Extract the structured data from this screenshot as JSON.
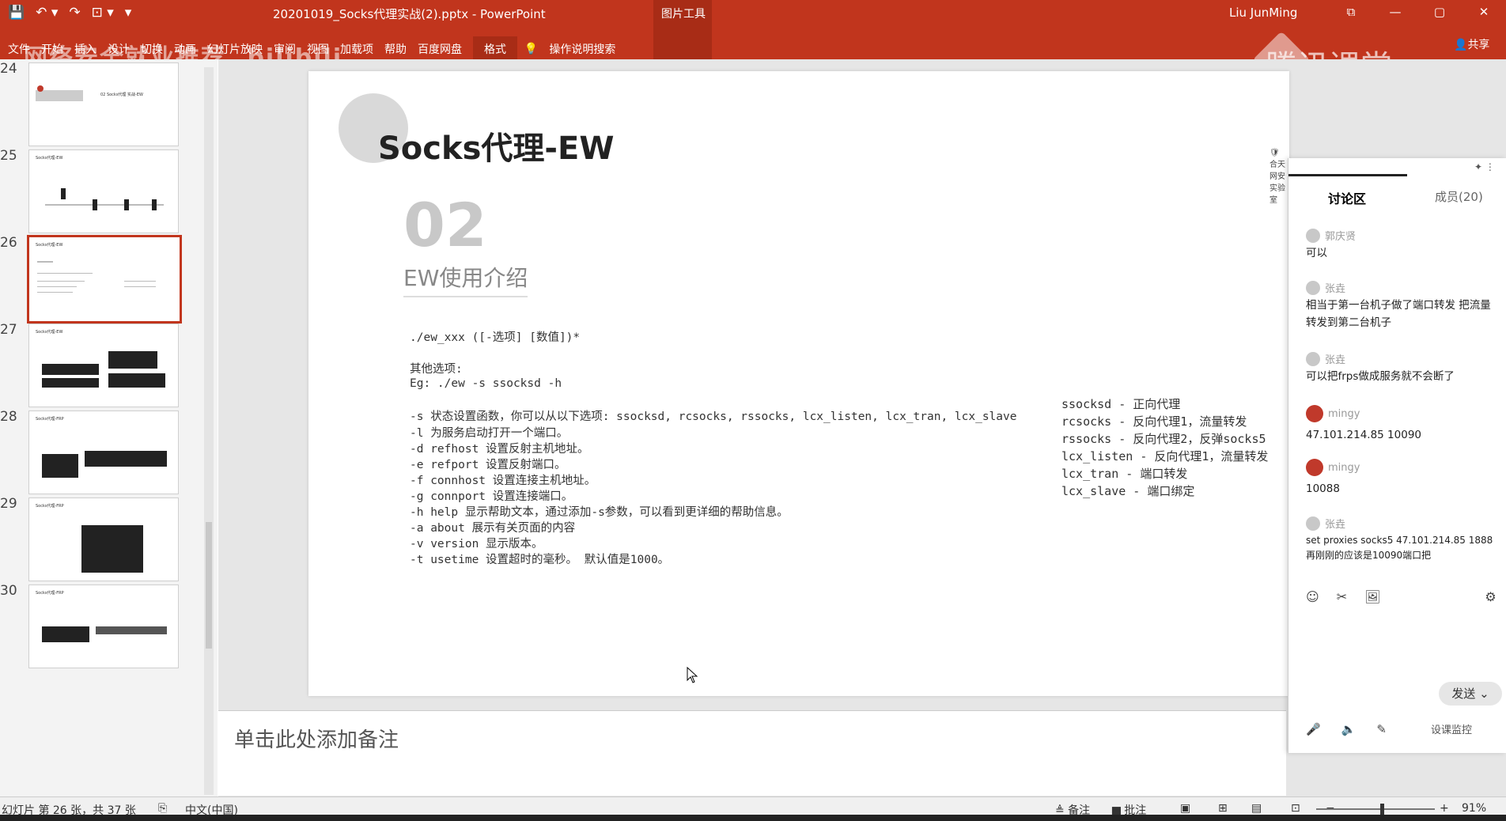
{
  "window": {
    "title": "20201019_Socks代理实战(2).pptx  -  PowerPoint",
    "context_tab": "图片工具",
    "user": "Liu JunMing",
    "controls": [
      "⧉",
      "—",
      "▢",
      "✕"
    ]
  },
  "qat": [
    "💾",
    "↶ ▾",
    "↷",
    "⊡ ▾",
    "▾"
  ],
  "ribbon": {
    "tabs": [
      "文件",
      "开始",
      "插入",
      "设计",
      "切换",
      "动画",
      "幻灯片放映",
      "审阅",
      "视图",
      "加载项",
      "帮助",
      "百度网盘",
      "格式"
    ],
    "active_tab": "格式",
    "search": "操作说明搜索",
    "share": "共享"
  },
  "watermarks": {
    "left": "网络安全就业推荐",
    "left_logo": "bilibili",
    "right": "腾讯课堂"
  },
  "thumbnails": [
    {
      "num": "24",
      "title": "02  Socks代理 实战-EW",
      "selected": false
    },
    {
      "num": "25",
      "title": "Socks代理-EW",
      "selected": false
    },
    {
      "num": "26",
      "title": "Socks代理-EW",
      "selected": true
    },
    {
      "num": "27",
      "title": "Socks代理-EW",
      "selected": false
    },
    {
      "num": "28",
      "title": "Socks代理-FRP",
      "selected": false
    },
    {
      "num": "29",
      "title": "Socks代理-FRP",
      "selected": false
    },
    {
      "num": "30",
      "title": "Socks代理-FRP",
      "selected": false
    }
  ],
  "slide": {
    "title": "Socks代理-EW",
    "logo_text": "合天网安实验室",
    "number": "02",
    "subtitle": "EW使用介绍",
    "lines": [
      "./ew_xxx ([-选项] [数值])*",
      "",
      "其他选项:",
      "Eg: ./ew -s ssocksd -h",
      "",
      "-s 状态设置函数，你可以从以下选项: ssocksd, rcsocks, rssocks, lcx_listen, lcx_tran, lcx_slave",
      "-l 为服务启动打开一个端口。",
      "-d refhost 设置反射主机地址。",
      "-e refport 设置反射端口。",
      "-f connhost 设置连接主机地址。",
      "-g connport 设置连接端口。",
      "-h help 显示帮助文本，通过添加-s参数，可以看到更详细的帮助信息。",
      "-a about 展示有关页面的内容",
      "-v version 显示版本。",
      "-t usetime 设置超时的毫秒。 默认值是1000。"
    ],
    "right_lines": [
      "ssocksd - 正向代理",
      "rcsocks - 反向代理1，流量转发",
      "rssocks - 反向代理2，反弹socks5",
      "lcx_listen - 反向代理1，流量转发",
      "lcx_tran - 端口转发",
      "lcx_slave - 端口绑定"
    ]
  },
  "notes_placeholder": "单击此处添加备注",
  "chat": {
    "tab_discussion": "讨论区",
    "tab_members": "成员(20)",
    "messages": [
      {
        "user": "郭庆贤",
        "text": "可以",
        "red": false
      },
      {
        "user": "张垚",
        "text": "相当于第一台机子做了端口转发  把流量转发到第二台机子",
        "red": false
      },
      {
        "user": "张垚",
        "text": "可以把frps做成服务就不会断了",
        "red": false
      },
      {
        "user": "mingy",
        "text": "47.101.214.85 10090",
        "red": true
      },
      {
        "user": "mingy",
        "text": "10088",
        "red": true
      },
      {
        "user": "张垚",
        "text": "set proxies socks5 47.101.214.85 1888  再刚刚的应该是10090端口把",
        "red": false
      }
    ],
    "tools": [
      "☺",
      "✂",
      "🖼",
      "⚙"
    ],
    "send": "发送",
    "bottom_icons": [
      "🎤",
      "🔈",
      "✎"
    ],
    "bottom_text": "设课监控"
  },
  "status": {
    "slide_info": "幻灯片 第 26 张，共 37 张",
    "lang": "中文(中国)",
    "notes": "≜ 备注",
    "comments": "▆ 批注",
    "zoom": "91%"
  }
}
